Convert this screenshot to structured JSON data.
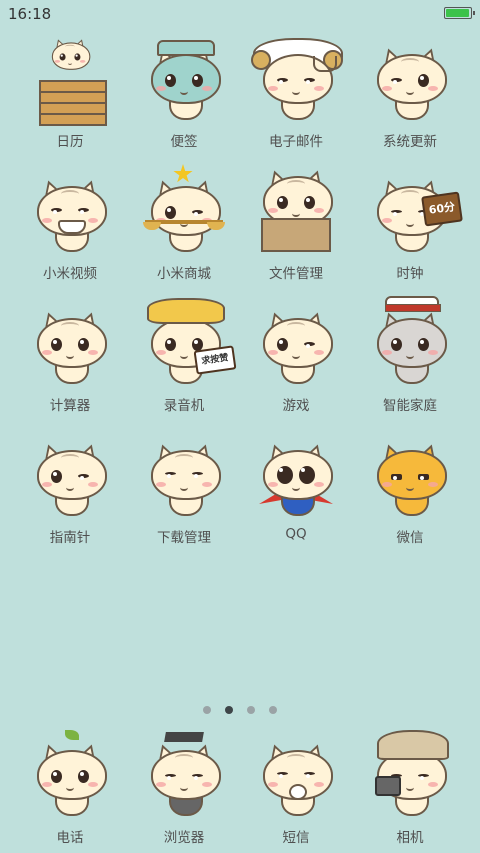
{
  "status_bar": {
    "time": "16:18",
    "battery_level": 0.9,
    "battery_color": "#3cc24a"
  },
  "grid_apps": [
    {
      "label": "日历",
      "icon": "calendar-cat-icon"
    },
    {
      "label": "便签",
      "icon": "notes-cat-icon"
    },
    {
      "label": "电子邮件",
      "icon": "email-cat-icon"
    },
    {
      "label": "系统更新",
      "icon": "system-update-cat-icon"
    },
    {
      "label": "小米视频",
      "icon": "video-cat-icon"
    },
    {
      "label": "小米商城",
      "icon": "mall-cat-icon"
    },
    {
      "label": "文件管理",
      "icon": "file-manager-cat-icon"
    },
    {
      "label": "时钟",
      "icon": "clock-cat-icon",
      "sign_text": "60分"
    },
    {
      "label": "计算器",
      "icon": "calculator-cat-icon"
    },
    {
      "label": "录音机",
      "icon": "recorder-cat-icon",
      "sign_text": "求按赞"
    },
    {
      "label": "游戏",
      "icon": "game-cat-icon"
    },
    {
      "label": "智能家庭",
      "icon": "smart-home-cat-icon"
    },
    {
      "label": "指南针",
      "icon": "compass-cat-icon"
    },
    {
      "label": "下载管理",
      "icon": "download-cat-icon"
    },
    {
      "label": "QQ",
      "icon": "qq-cat-icon"
    },
    {
      "label": "微信",
      "icon": "wechat-cat-icon"
    }
  ],
  "page_indicator": {
    "count": 4,
    "active": 2
  },
  "dock_apps": [
    {
      "label": "电话",
      "icon": "phone-cat-icon"
    },
    {
      "label": "浏览器",
      "icon": "browser-cat-icon"
    },
    {
      "label": "短信",
      "icon": "sms-cat-icon"
    },
    {
      "label": "相机",
      "icon": "camera-cat-icon"
    }
  ],
  "colors": {
    "background": "#bfe0dc",
    "label": "#505050",
    "dot_active": "#3e4548",
    "dot_inactive": "#9aa3a6"
  }
}
